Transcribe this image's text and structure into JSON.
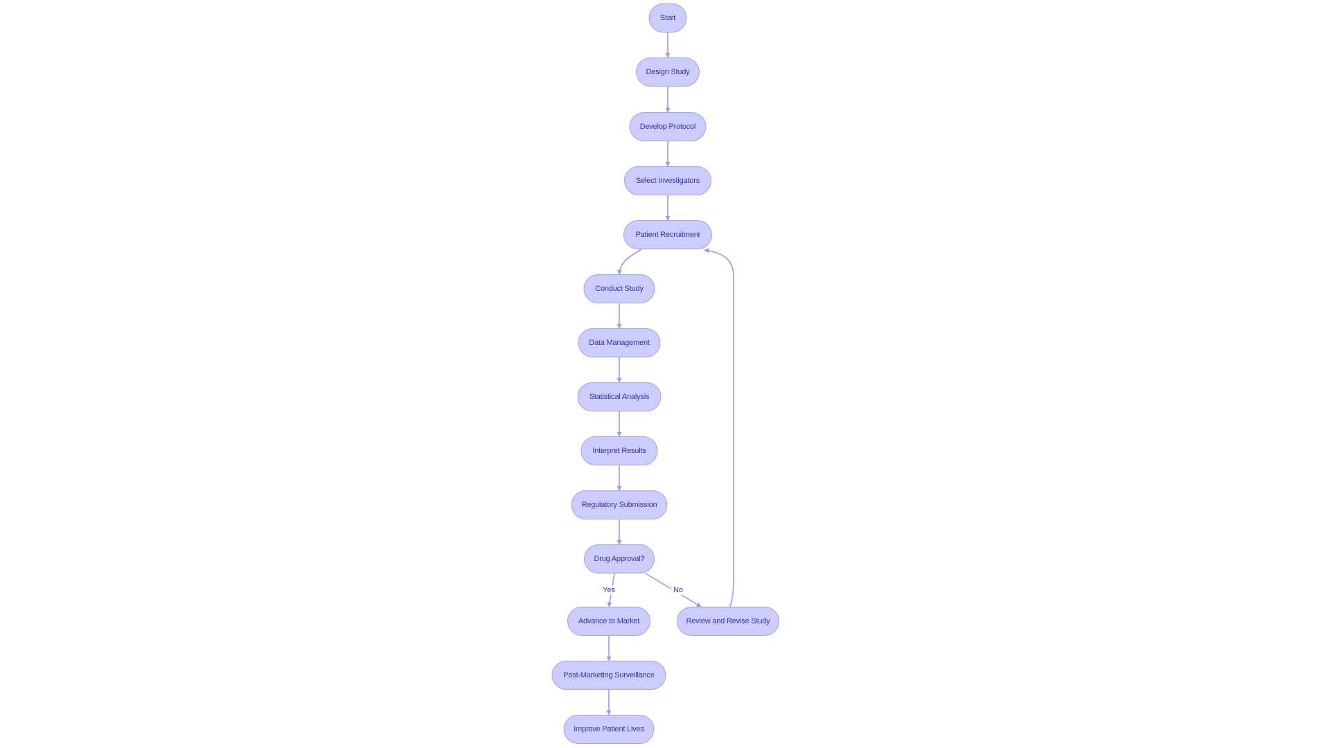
{
  "diagram": {
    "type": "flowchart",
    "direction": "top-down",
    "colors": {
      "node_fill": "#ccccff",
      "node_border": "#a3a3e8",
      "node_text": "#3535a8",
      "edge": "#9a9ae8",
      "background": "#ffffff"
    },
    "nodes": [
      {
        "id": "start",
        "label": "Start"
      },
      {
        "id": "design",
        "label": "Design Study"
      },
      {
        "id": "protocol",
        "label": "Develop Protocol"
      },
      {
        "id": "investigators",
        "label": "Select Investigators"
      },
      {
        "id": "recruitment",
        "label": "Patient Recruitment"
      },
      {
        "id": "conduct",
        "label": "Conduct Study"
      },
      {
        "id": "datamgmt",
        "label": "Data Management"
      },
      {
        "id": "stats",
        "label": "Statistical Analysis"
      },
      {
        "id": "interpret",
        "label": "Interpret Results"
      },
      {
        "id": "submission",
        "label": "Regulatory Submission"
      },
      {
        "id": "approval",
        "label": "Drug Approval?"
      },
      {
        "id": "market",
        "label": "Advance to Market"
      },
      {
        "id": "revise",
        "label": "Review and Revise Study"
      },
      {
        "id": "surveillance",
        "label": "Post-Marketing Surveillance"
      },
      {
        "id": "improve",
        "label": "Improve Patient Lives"
      }
    ],
    "edges": [
      {
        "from": "start",
        "to": "design",
        "label": ""
      },
      {
        "from": "design",
        "to": "protocol",
        "label": ""
      },
      {
        "from": "protocol",
        "to": "investigators",
        "label": ""
      },
      {
        "from": "investigators",
        "to": "recruitment",
        "label": ""
      },
      {
        "from": "recruitment",
        "to": "conduct",
        "label": ""
      },
      {
        "from": "conduct",
        "to": "datamgmt",
        "label": ""
      },
      {
        "from": "datamgmt",
        "to": "stats",
        "label": ""
      },
      {
        "from": "stats",
        "to": "interpret",
        "label": ""
      },
      {
        "from": "interpret",
        "to": "submission",
        "label": ""
      },
      {
        "from": "submission",
        "to": "approval",
        "label": ""
      },
      {
        "from": "approval",
        "to": "market",
        "label": "Yes"
      },
      {
        "from": "approval",
        "to": "revise",
        "label": "No"
      },
      {
        "from": "revise",
        "to": "recruitment",
        "label": ""
      },
      {
        "from": "market",
        "to": "surveillance",
        "label": ""
      },
      {
        "from": "surveillance",
        "to": "improve",
        "label": ""
      }
    ]
  }
}
